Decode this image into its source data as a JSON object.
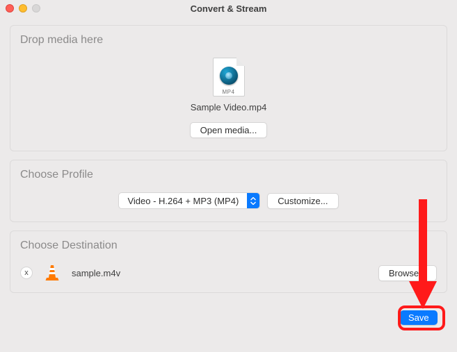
{
  "window": {
    "title": "Convert & Stream"
  },
  "drop": {
    "title": "Drop media here",
    "file_type_badge": "MP4",
    "filename": "Sample Video.mp4",
    "open_media_label": "Open media..."
  },
  "profile": {
    "title": "Choose Profile",
    "selected": "Video - H.264 + MP3 (MP4)",
    "customize_label": "Customize..."
  },
  "destination": {
    "title": "Choose Destination",
    "file": "sample.m4v",
    "browse_label": "Browse...",
    "clear_label": "x"
  },
  "actions": {
    "save_label": "Save"
  }
}
